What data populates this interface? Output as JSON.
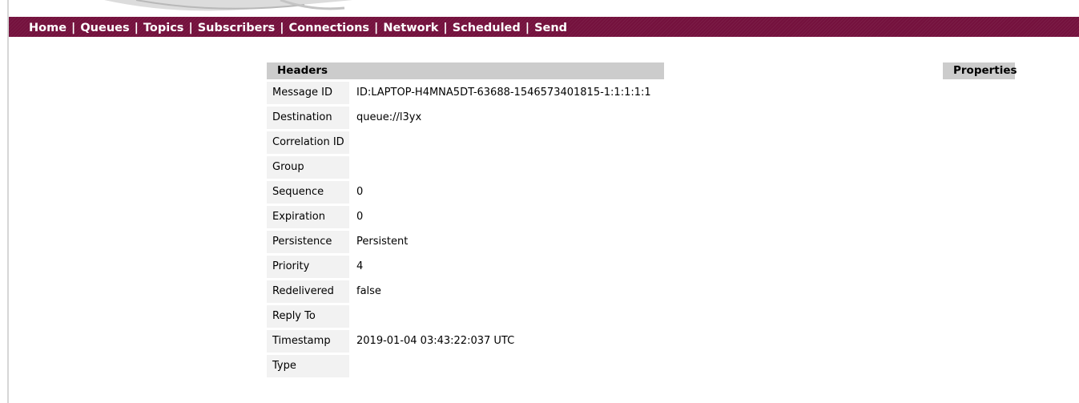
{
  "nav": {
    "items": [
      {
        "label": "Home"
      },
      {
        "label": "Queues"
      },
      {
        "label": "Topics"
      },
      {
        "label": "Subscribers"
      },
      {
        "label": "Connections"
      },
      {
        "label": "Network"
      },
      {
        "label": "Scheduled"
      },
      {
        "label": "Send"
      }
    ],
    "separator": "|"
  },
  "headers": {
    "title": "Headers",
    "rows": [
      {
        "label": "Message ID",
        "value": "ID:LAPTOP-H4MNA5DT-63688-1546573401815-1:1:1:1:1"
      },
      {
        "label": "Destination",
        "value": "queue://l3yx"
      },
      {
        "label": "Correlation ID",
        "value": ""
      },
      {
        "label": "Group",
        "value": ""
      },
      {
        "label": "Sequence",
        "value": "0"
      },
      {
        "label": "Expiration",
        "value": "0"
      },
      {
        "label": "Persistence",
        "value": "Persistent"
      },
      {
        "label": "Priority",
        "value": "4"
      },
      {
        "label": "Redelivered",
        "value": "false"
      },
      {
        "label": "Reply To",
        "value": ""
      },
      {
        "label": "Timestamp",
        "value": "2019-01-04 03:43:22:037 UTC"
      },
      {
        "label": "Type",
        "value": ""
      }
    ]
  },
  "properties": {
    "title": "Properties"
  },
  "colors": {
    "navbar": "#74113d",
    "section_header": "#cccccc",
    "label_cell": "#f2f2f2"
  }
}
